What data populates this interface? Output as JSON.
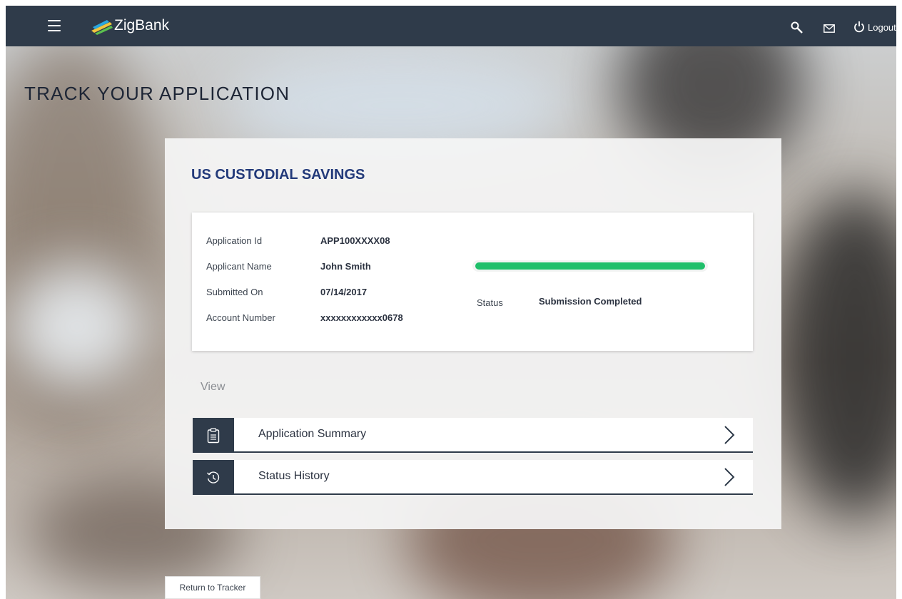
{
  "header": {
    "brand": "ZigBank",
    "logout_label": "Logout",
    "icons": [
      "menu-icon",
      "zigbank-logo",
      "search-icon",
      "mail-icon",
      "power-icon"
    ]
  },
  "page": {
    "title": "TRACK YOUR APPLICATION"
  },
  "application": {
    "product_title": "US CUSTODIAL SAVINGS",
    "fields": [
      {
        "label": "Application Id",
        "value": "APP100XXXX08"
      },
      {
        "label": "Applicant Name",
        "value": "John Smith"
      },
      {
        "label": "Submitted On",
        "value": "07/14/2017"
      },
      {
        "label": "Account Number",
        "value": "xxxxxxxxxxxx0678"
      }
    ],
    "progress": 1.0,
    "status_label": "Status",
    "status_value": "Submission Completed"
  },
  "view": {
    "label": "View",
    "links": [
      {
        "label": "Application Summary",
        "icon": "clipboard-icon"
      },
      {
        "label": "Status History",
        "icon": "history-icon"
      }
    ]
  },
  "footer": {
    "return_label": "Return to Tracker"
  },
  "colors": {
    "header": "#2f3b4a",
    "title": "#233a7a",
    "progress": "#1fbf6a"
  }
}
